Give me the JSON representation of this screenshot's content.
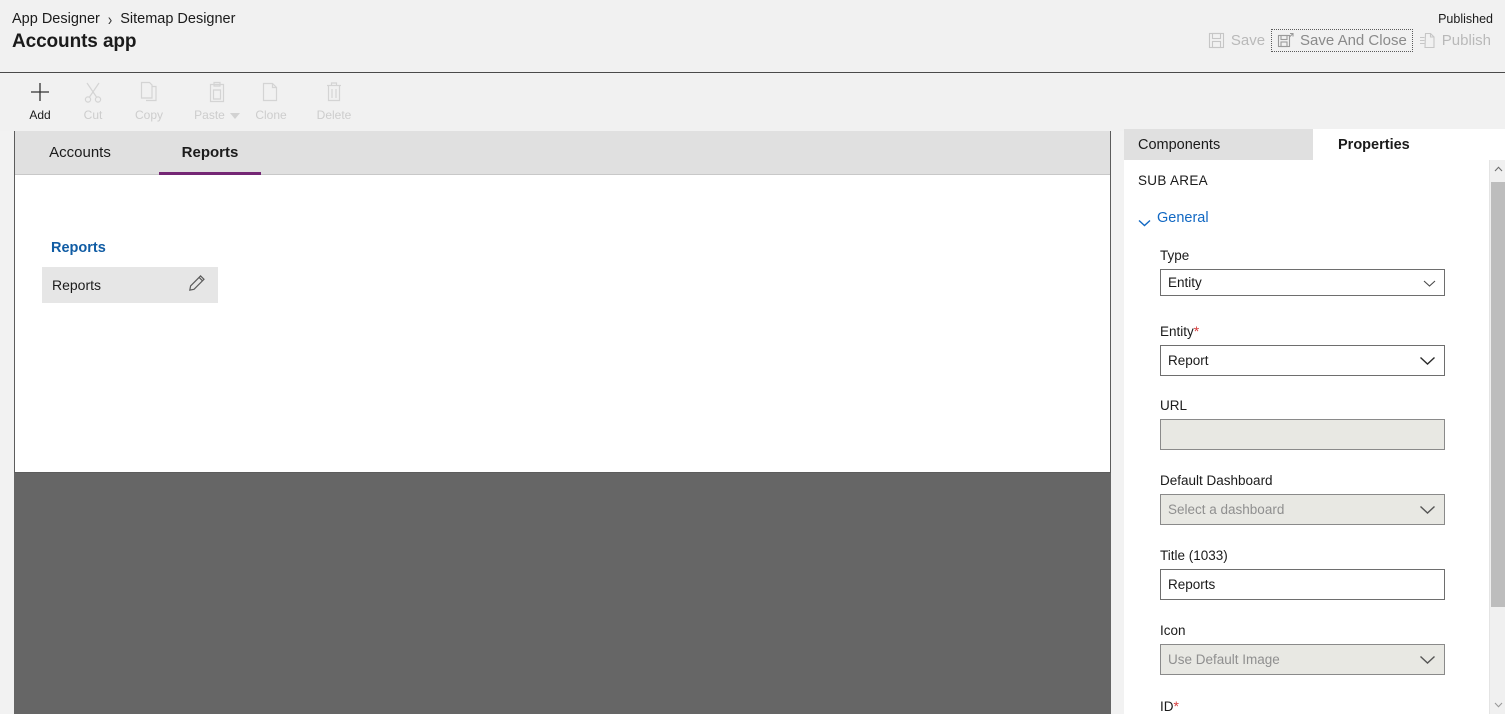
{
  "header": {
    "breadcrumb": [
      {
        "label": "App Designer"
      },
      {
        "label": "Sitemap Designer"
      }
    ],
    "separator": "›",
    "app_title": "Accounts app",
    "published_status": "Published",
    "actions": [
      {
        "name": "save",
        "label": "Save",
        "icon": "save-icon",
        "enabled": false,
        "focused": false
      },
      {
        "name": "save-and-close",
        "label": "Save And Close",
        "icon": "save-and-close-icon",
        "enabled": false,
        "focused": true
      },
      {
        "name": "publish",
        "label": "Publish",
        "icon": "publish-icon",
        "enabled": false,
        "focused": false
      }
    ]
  },
  "commandbar": {
    "items": [
      {
        "label": "Add",
        "icon": "plus-icon",
        "enabled": true,
        "has_caret": false
      },
      {
        "label": "Cut",
        "icon": "scissors-icon",
        "enabled": false,
        "has_caret": false
      },
      {
        "label": "Copy",
        "icon": "copy-icon",
        "enabled": false,
        "has_caret": false
      },
      {
        "label": "Paste",
        "icon": "clipboard-icon",
        "enabled": false,
        "has_caret": true
      },
      {
        "label": "Clone",
        "icon": "clone-icon",
        "enabled": false,
        "has_caret": false
      },
      {
        "label": "Delete",
        "icon": "trash-icon",
        "enabled": false,
        "has_caret": false
      }
    ]
  },
  "canvas": {
    "tabs": [
      {
        "label": "Accounts",
        "active": false
      },
      {
        "label": "Reports",
        "active": true
      }
    ],
    "group_title": "Reports",
    "subarea_card": {
      "label": "Reports",
      "edit_icon": "pencil-icon"
    }
  },
  "properties_panel": {
    "tabs": [
      {
        "label": "Components",
        "active": false
      },
      {
        "label": "Properties",
        "active": true
      }
    ],
    "section_label": "SUB AREA",
    "general_group": {
      "label": "General",
      "expanded": true,
      "chevron_icon": "chevron-down-icon"
    },
    "fields": {
      "type": {
        "label": "Type",
        "value": "Entity",
        "required": false,
        "disabled": false,
        "control": "select"
      },
      "entity": {
        "label": "Entity",
        "value": "Report",
        "required": true,
        "required_marker": "*",
        "disabled": false,
        "control": "select"
      },
      "url": {
        "label": "URL",
        "value": "",
        "placeholder": "",
        "required": false,
        "disabled": true,
        "control": "text"
      },
      "default_dashboard": {
        "label": "Default Dashboard",
        "value": "Select a dashboard",
        "required": false,
        "disabled": true,
        "control": "select"
      },
      "title": {
        "label": "Title (1033)",
        "value": "Reports",
        "required": false,
        "disabled": false,
        "control": "text"
      },
      "icon": {
        "label": "Icon",
        "value": "Use Default Image",
        "required": false,
        "disabled": true,
        "control": "select"
      },
      "id": {
        "label": "ID",
        "required": true,
        "required_marker": "*",
        "control": "text"
      }
    }
  },
  "colors": {
    "accent_tab_underline": "#742774",
    "link_blue": "#105ca4",
    "group_blue": "#1168c3",
    "required_red": "#d53b3b",
    "header_bg": "#f1f1f1",
    "tabbar_bg": "#e0e0e0",
    "blocked_overlay": "#666666"
  }
}
